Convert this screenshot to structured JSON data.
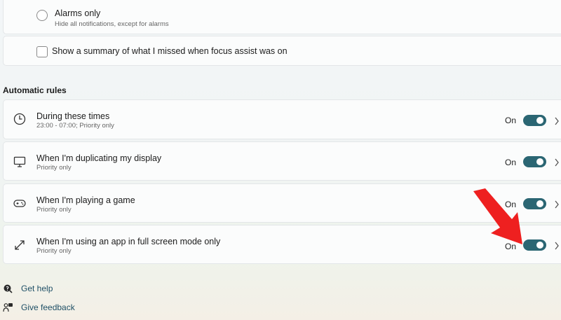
{
  "focus_options": {
    "alarms_only": {
      "title": "Alarms only",
      "subtitle": "Hide all notifications, except for alarms"
    },
    "summary_checkbox": {
      "label": "Show a summary of what I missed when focus assist was on"
    }
  },
  "automatic_rules": {
    "heading": "Automatic rules",
    "rules": [
      {
        "title": "During these times",
        "subtitle": "23:00 - 07:00; Priority only",
        "state": "On",
        "icon": "clock-icon",
        "enabled": true
      },
      {
        "title": "When I'm duplicating my display",
        "subtitle": "Priority only",
        "state": "On",
        "icon": "monitor-icon",
        "enabled": true
      },
      {
        "title": "When I'm playing a game",
        "subtitle": "Priority only",
        "state": "On",
        "icon": "gamepad-icon",
        "enabled": true
      },
      {
        "title": "When I'm using an app in full screen mode only",
        "subtitle": "Priority only",
        "state": "On",
        "icon": "fullscreen-icon",
        "enabled": true
      }
    ]
  },
  "links": {
    "get_help": "Get help",
    "give_feedback": "Give feedback"
  },
  "colors": {
    "accent": "#2b6673",
    "annotation_arrow": "#ee2020"
  }
}
